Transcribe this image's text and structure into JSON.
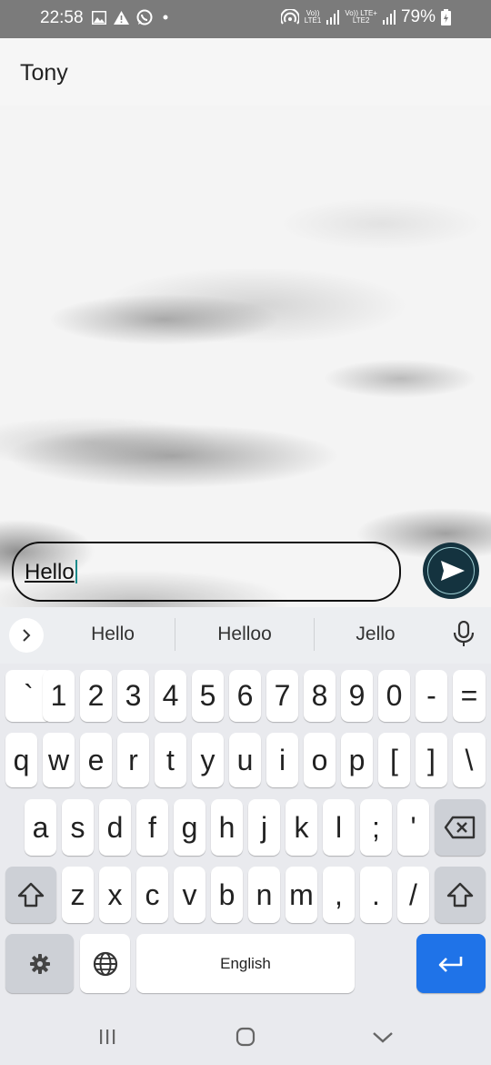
{
  "status_bar": {
    "time": "22:58",
    "sim1_top": "Vo))",
    "sim1_bottom": "LTE1",
    "sim2_top": "Vo)) LTE+",
    "sim2_bottom": "LTE2",
    "battery": "79%"
  },
  "header": {
    "title": "Tony"
  },
  "composer": {
    "text": "Hello"
  },
  "suggestions": [
    "Hello",
    "Helloo",
    "Jello"
  ],
  "keyboard": {
    "row1": [
      "`",
      "1",
      "2",
      "3",
      "4",
      "5",
      "6",
      "7",
      "8",
      "9",
      "0",
      "-",
      "="
    ],
    "row2": [
      "q",
      "w",
      "e",
      "r",
      "t",
      "y",
      "u",
      "i",
      "o",
      "p",
      "[",
      "]",
      "\\"
    ],
    "row3": [
      "a",
      "s",
      "d",
      "f",
      "g",
      "h",
      "j",
      "k",
      "l",
      ";",
      "'"
    ],
    "row4": [
      "z",
      "x",
      "c",
      "v",
      "b",
      "n",
      "m",
      ",",
      ".",
      "/"
    ],
    "space_label": "English"
  },
  "colors": {
    "send_button": "#14333f",
    "enter_key": "#1f73e8",
    "caret": "#1a8a8a"
  }
}
